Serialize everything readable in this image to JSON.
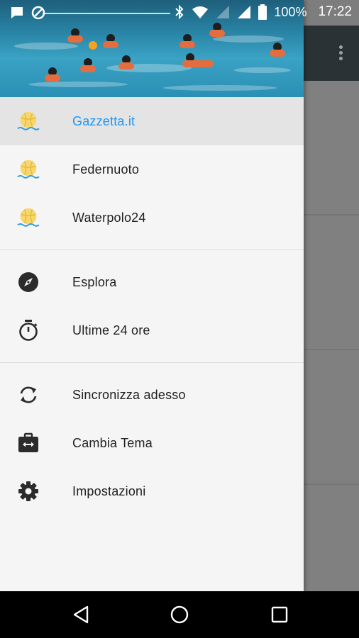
{
  "status_bar": {
    "battery": "100%",
    "time": "17:22",
    "icons": [
      "message-icon",
      "blocked-icon",
      "bluetooth-icon",
      "wifi-icon",
      "signal-icon",
      "signal-icon",
      "battery-icon"
    ]
  },
  "drawer": {
    "sources": [
      {
        "label": "Gazzetta.it",
        "icon": "waterpolo-ball-icon",
        "active": true
      },
      {
        "label": "Federnuoto",
        "icon": "waterpolo-ball-icon",
        "active": false
      },
      {
        "label": "Waterpolo24",
        "icon": "waterpolo-ball-icon",
        "active": false
      }
    ],
    "navigation": [
      {
        "label": "Esplora",
        "icon": "compass-icon"
      },
      {
        "label": "Ultime 24 ore",
        "icon": "timer-icon"
      }
    ],
    "actions": [
      {
        "label": "Sincronizza adesso",
        "icon": "sync-icon"
      },
      {
        "label": "Cambia Tema",
        "icon": "switch-theme-icon"
      },
      {
        "label": "Impostazioni",
        "icon": "settings-icon"
      }
    ]
  },
  "colors": {
    "accent": "#2196f3",
    "toolbar": "#2a3236",
    "ball": "#f7d66b"
  }
}
